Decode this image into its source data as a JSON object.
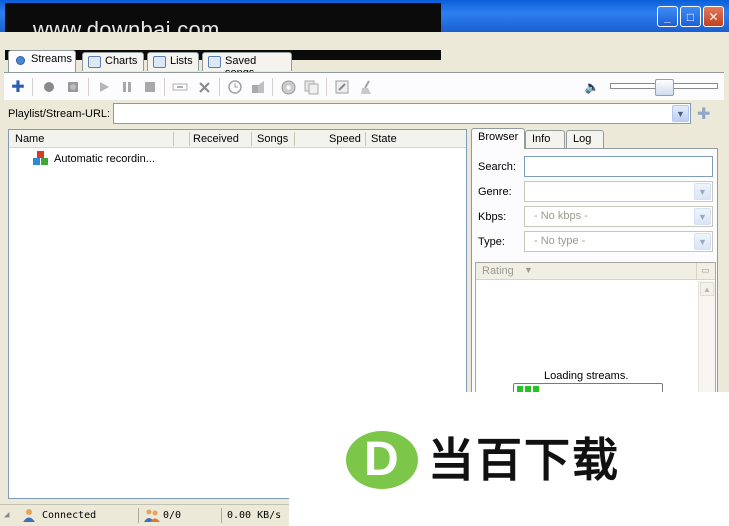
{
  "watermark": "www.downbai.com",
  "window_buttons": {
    "minimize": "_",
    "maximize": "□",
    "close": "✕"
  },
  "tabs": [
    {
      "label": "Streams",
      "icon": "streams-icon"
    },
    {
      "label": "Charts",
      "icon": "charts-icon"
    },
    {
      "label": "Lists",
      "icon": "lists-icon"
    },
    {
      "label": "Saved songs",
      "icon": "saved-songs-icon"
    }
  ],
  "toolbar": {
    "icons": [
      "add-icon",
      "record-icon",
      "stop-record-icon",
      "play-icon",
      "pause-icon",
      "stop-icon",
      "cut-icon",
      "delete-icon",
      "timer-icon",
      "note-icon",
      "disc-icon",
      "copy-icon",
      "edit-icon",
      "clean-icon"
    ],
    "add_glyph": "✚",
    "volume_icon": "speaker-icon",
    "volume_glyph": "🔈",
    "volume_level": 0.5
  },
  "url_row": {
    "label": "Playlist/Stream-URL:",
    "value": "",
    "add_glyph": "✚"
  },
  "list": {
    "columns": [
      "Name",
      "Received",
      "Songs",
      "Speed",
      "State"
    ],
    "rows": [
      {
        "name": "Automatic recordin...",
        "icon": "recording-icon"
      }
    ]
  },
  "right_panel": {
    "tabs": [
      "Browser",
      "Info",
      "Log"
    ],
    "active_tab": "Browser",
    "search_label": "Search:",
    "search_value": "",
    "genre_label": "Genre:",
    "genre_value": "",
    "kbps_label": "Kbps:",
    "kbps_value": "- No kbps -",
    "type_label": "Type:",
    "type_value": "- No type -",
    "rating_header": "Rating",
    "loading_text": "Loading streams.",
    "loading_progress": 0.2
  },
  "status": {
    "connection": "Connected",
    "count": "0/0",
    "speed": "0.00 KB/s"
  },
  "logo": {
    "letter": "D",
    "text": "当百下载",
    "color": "#7cc64a"
  }
}
